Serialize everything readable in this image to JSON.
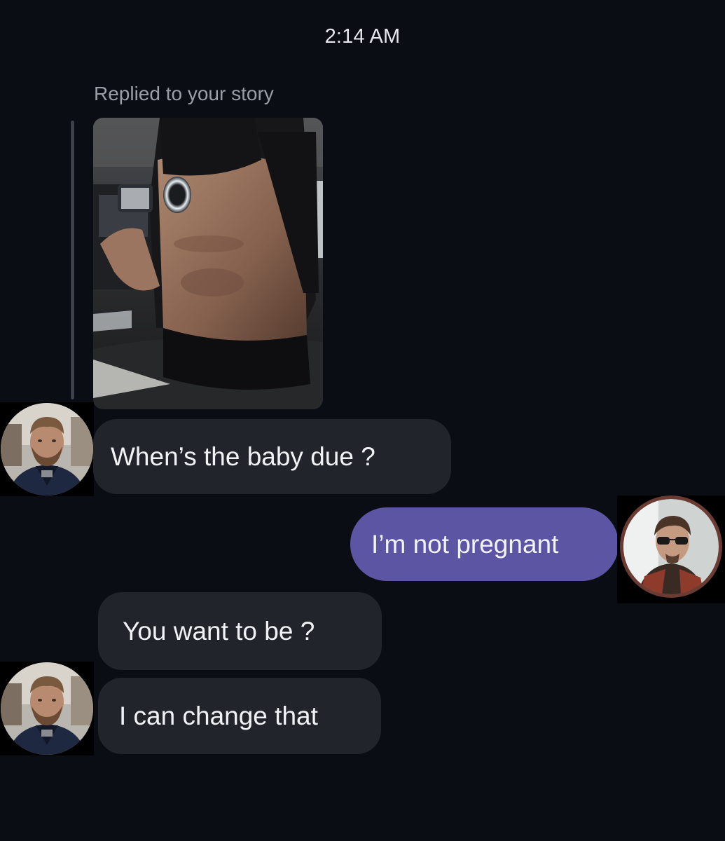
{
  "thread": {
    "timestamp": "2:14 AM",
    "reply_label": "Replied to your story"
  },
  "messages": [
    {
      "sender": "them",
      "text": "When’s the baby due ?"
    },
    {
      "sender": "me",
      "text": "I’m not pregnant"
    },
    {
      "sender": "them",
      "text": "You want to be ?"
    },
    {
      "sender": "them",
      "text": "I can change that"
    }
  ],
  "colors": {
    "background": "#0b0d14",
    "incoming_bubble": "#22242b",
    "outgoing_bubble": "#5b55a3",
    "avatar_ring": "#6b3a33"
  }
}
